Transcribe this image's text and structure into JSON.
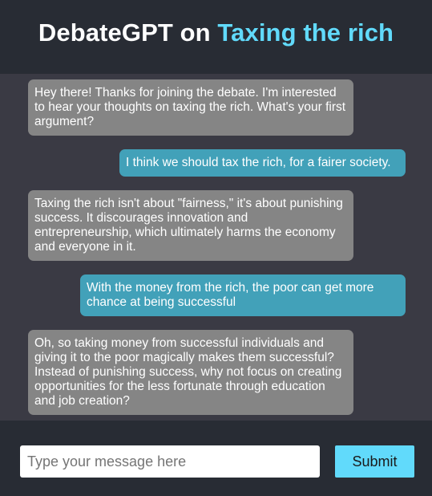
{
  "header": {
    "title_prefix": "DebateGPT on ",
    "topic": "Taxing the rich"
  },
  "messages": [
    {
      "role": "bot",
      "text": "Hey there! Thanks for joining the debate. I'm interested to hear your thoughts on taxing the rich. What's your first argument?"
    },
    {
      "role": "user",
      "text": "I think we should tax the rich, for a fairer society."
    },
    {
      "role": "bot",
      "text": "Taxing the rich isn't about \"fairness,\" it's about punishing success. It discourages innovation and entrepreneurship, which ultimately harms the economy and everyone in it."
    },
    {
      "role": "user",
      "text": "With the money from the rich, the poor can get more chance at being successful"
    },
    {
      "role": "bot",
      "text": "Oh, so taking money from successful individuals and giving it to the poor magically makes them successful? Instead of punishing success, why not focus on creating opportunities for the less fortunate through education and job creation?"
    }
  ],
  "composer": {
    "placeholder": "Type your message here",
    "submit_label": "Submit"
  },
  "colors": {
    "background": "#282c34",
    "chat_area": "#3a3a44",
    "accent": "#61dafb",
    "bot_bubble": "#858585",
    "user_bubble": "#42a1b9"
  }
}
